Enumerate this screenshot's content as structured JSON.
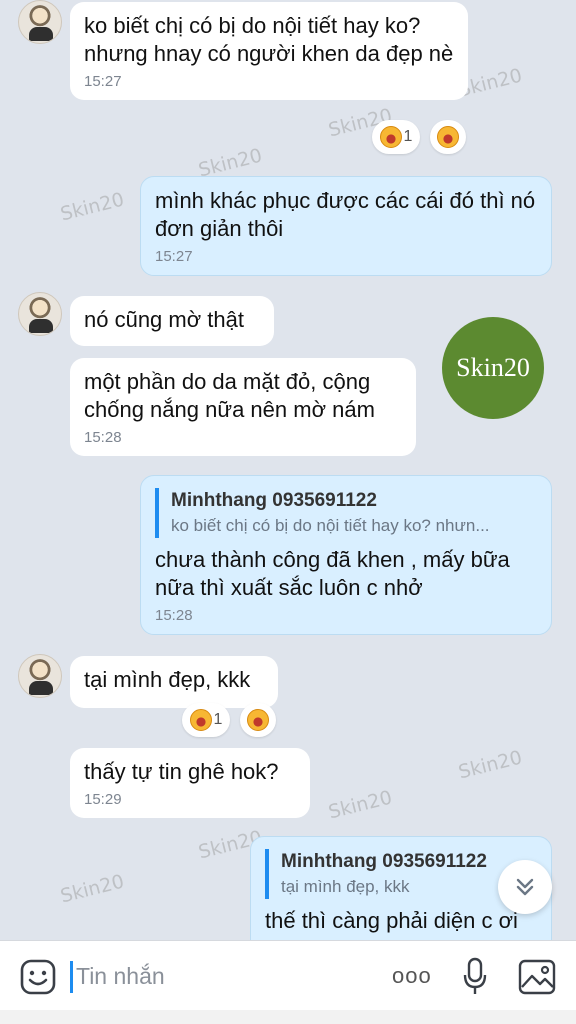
{
  "watermark": "Skin20",
  "logo": {
    "text": "Skin20",
    "color": "#5c8a30"
  },
  "messages": [
    {
      "from": "in",
      "text": "ko biết chị có bị do nội tiết hay ko?\nnhưng hnay có người khen da đẹp nè",
      "time": "15:27",
      "reactions": {
        "count": "1"
      }
    },
    {
      "from": "out",
      "text": "mình khác phục được các cái đó thì nó đơn giản thôi",
      "time": "15:27"
    },
    {
      "from": "in",
      "text": "nó cũng mờ thật"
    },
    {
      "from": "in",
      "text": "một phần do da mặt đỏ, cộng chống nắng nữa nên mờ nám",
      "time": "15:28"
    },
    {
      "from": "out",
      "quote": {
        "name": "Minhthang 0935691122",
        "snippet": "ko biết chị có bị do nội tiết hay ko? nhưn..."
      },
      "text": "chưa thành công đã khen , mấy bữa nữa thì xuất sắc luôn c nhở",
      "time": "15:28"
    },
    {
      "from": "in",
      "text": "tại mình đẹp, kkk",
      "reactions": {
        "count": "1"
      }
    },
    {
      "from": "in",
      "text": "thấy tự tin ghê hok?",
      "time": "15:29"
    },
    {
      "from": "out",
      "quote": {
        "name": "Minhthang 0935691122",
        "snippet": "tại mình đẹp, kkk"
      },
      "text": "thế thì càng phải diện c ơi"
    }
  ],
  "composer": {
    "placeholder": "Tin nhắn",
    "more_label": "ooo"
  },
  "icons": {
    "emoji": "emoji-icon",
    "mic": "microphone-icon",
    "image": "image-icon",
    "scroll": "chevron-double-down-icon",
    "reaction": "laugh-emoji-icon"
  },
  "colors": {
    "accent": "#1d8cf0",
    "out_bubble": "#d9efff",
    "background": "#dfe4ec"
  }
}
